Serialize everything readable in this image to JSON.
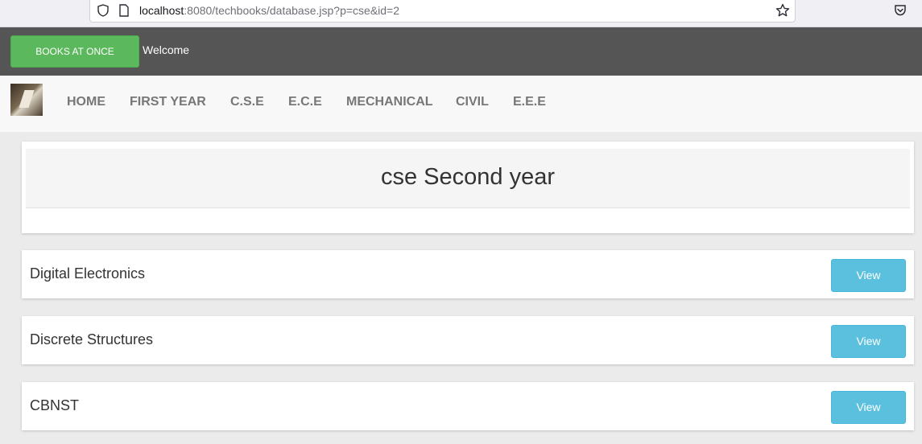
{
  "browser": {
    "url_host": "localhost",
    "url_rest": ":8080/techbooks/database.jsp?p=cse&id=2"
  },
  "topbar": {
    "brand_label": "BOOKS AT ONCE",
    "welcome_text": "Welcome"
  },
  "nav": {
    "items": [
      {
        "label": "HOME"
      },
      {
        "label": "FIRST YEAR"
      },
      {
        "label": "C.S.E"
      },
      {
        "label": "E.C.E"
      },
      {
        "label": "MECHANICAL"
      },
      {
        "label": "CIVIL"
      },
      {
        "label": "E.E.E"
      }
    ]
  },
  "page": {
    "title": "cse Second year"
  },
  "books": [
    {
      "title": "Digital Electronics",
      "action_label": "View"
    },
    {
      "title": "Discrete Structures",
      "action_label": "View"
    },
    {
      "title": "CBNST",
      "action_label": "View"
    }
  ],
  "colors": {
    "topbar_bg": "#555555",
    "brand_green": "#5cb85c",
    "view_button": "#5bc0de",
    "nav_text": "#777777"
  }
}
